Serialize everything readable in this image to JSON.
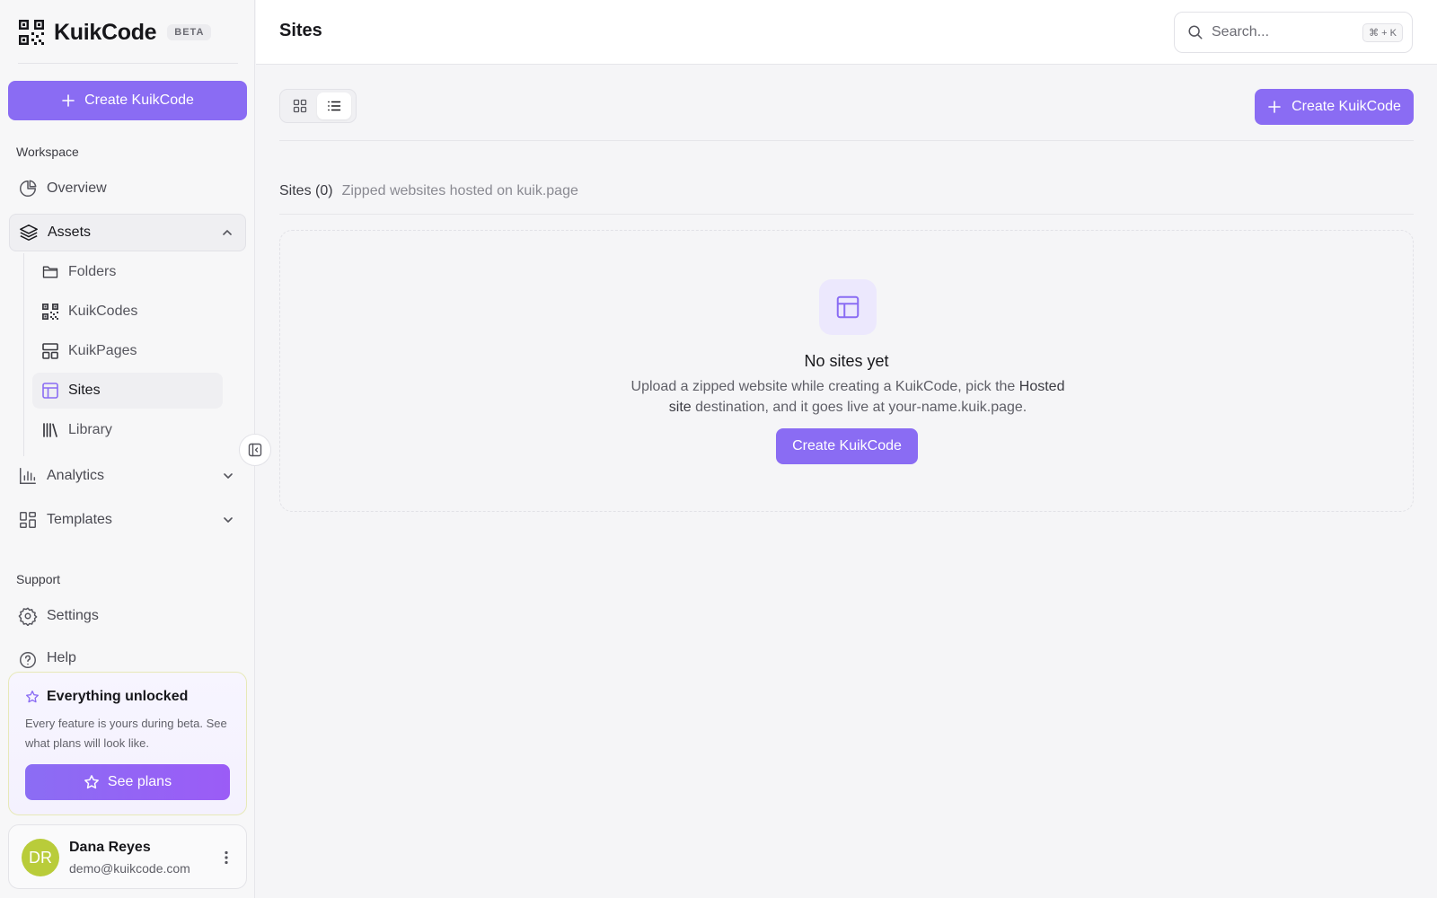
{
  "brand": {
    "name": "KuikCode",
    "badge": "BETA"
  },
  "sidebar": {
    "create_label": "Create KuikCode",
    "workspace_label": "Workspace",
    "overview": "Overview",
    "assets": "Assets",
    "sub_items": [
      "Folders",
      "KuikCodes",
      "KuikPages",
      "Sites",
      "Library"
    ],
    "active_sub_item": "Sites",
    "analytics": "Analytics",
    "templates": "Templates",
    "support_label": "Support",
    "settings": "Settings",
    "help": "Help"
  },
  "promo": {
    "title": "Everything unlocked",
    "description": "Every feature is yours during beta. See what plans will look like.",
    "button": "See plans"
  },
  "user": {
    "initials": "DR",
    "name": "Dana Reyes",
    "email": "demo@kuikcode.com",
    "avatar_color": "#b9cc3a"
  },
  "header": {
    "title": "Sites",
    "search_placeholder": "Search...",
    "search_shortcut": "⌘ + K"
  },
  "main": {
    "view_mode": "list",
    "create_label": "Create KuikCode",
    "section_title": "Sites (0)",
    "section_subtitle": "Zipped websites hosted on kuik.page",
    "empty": {
      "title": "No sites yet",
      "desc_part1": "Upload a zipped website while creating a KuikCode, pick the ",
      "desc_bold": "Hosted site",
      "desc_part2": " destination, and it goes live at your-name.kuik.page.",
      "button": "Create KuikCode"
    }
  },
  "colors": {
    "accent": "#8a6cf3",
    "accent_soft": "#ece8fd"
  }
}
